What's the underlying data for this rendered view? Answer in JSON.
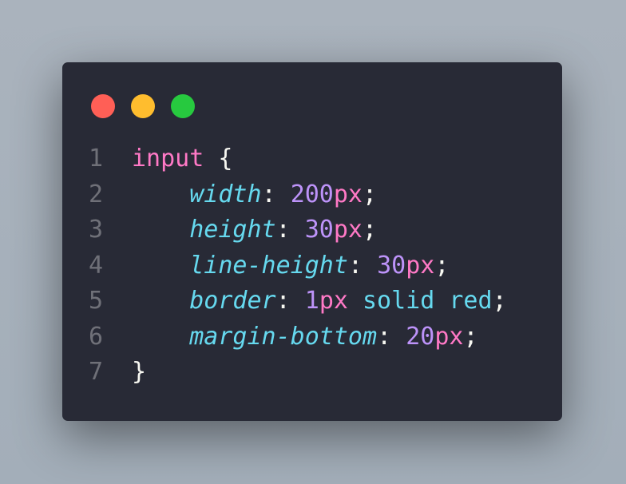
{
  "window_controls": [
    {
      "name": "close",
      "color": "#ff5f56"
    },
    {
      "name": "minimize",
      "color": "#ffbd2e"
    },
    {
      "name": "maximize",
      "color": "#27c93f"
    }
  ],
  "code": {
    "line_numbers": [
      "1",
      "2",
      "3",
      "4",
      "5",
      "6",
      "7"
    ],
    "selector": "input",
    "open_brace": "{",
    "close_brace": "}",
    "declarations": [
      {
        "property": "width",
        "number": "200",
        "unit": "px",
        "rest": ""
      },
      {
        "property": "height",
        "number": "30",
        "unit": "px",
        "rest": ""
      },
      {
        "property": "line-height",
        "number": "30",
        "unit": "px",
        "rest": ""
      },
      {
        "property": "border",
        "number": "1",
        "unit": "px",
        "rest": " solid red"
      },
      {
        "property": "margin-bottom",
        "number": "20",
        "unit": "px",
        "rest": ""
      }
    ]
  },
  "colors": {
    "background": "#282a36",
    "selector": "#ff79c6",
    "property": "#66d9ef",
    "number": "#bd93f9"
  }
}
